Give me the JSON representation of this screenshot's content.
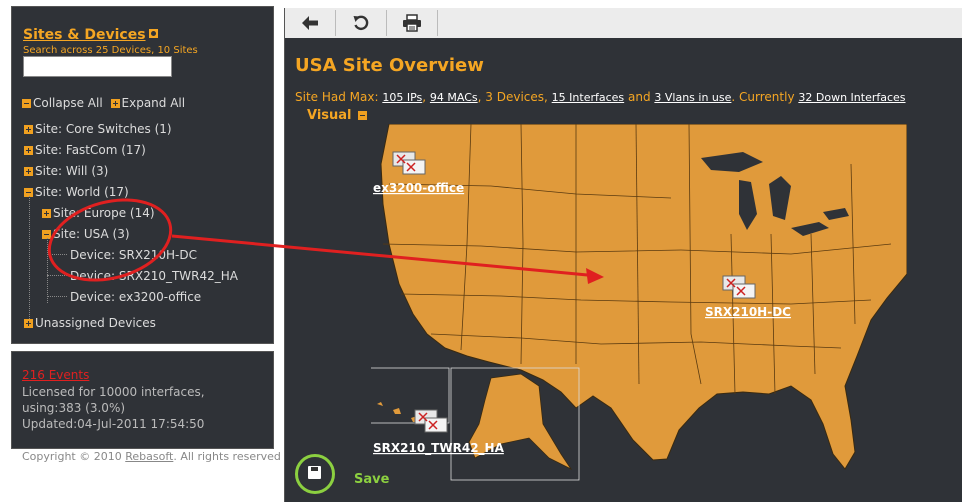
{
  "sidebar": {
    "title": "Sites & Devices",
    "subtitle": "Search across 25 Devices, 10 Sites",
    "search_value": "",
    "collapse_all": "Collapse All",
    "expand_all": "Expand All",
    "tree": {
      "core_switches": "Site: Core Switches (1)",
      "fastcom": "Site: FastCom (17)",
      "will": "Site: Will (3)",
      "world": "Site: World (17)",
      "europe": "Site: Europe (14)",
      "usa": "Site: USA (3)",
      "device_1": "Device: SRX210H-DC",
      "device_2": "Device: SRX210_TWR42_HA",
      "device_3": "Device: ex3200-office",
      "unassigned": "Unassigned Devices"
    }
  },
  "events": {
    "link": "216 Events",
    "licensed": "Licensed for 10000 interfaces, using:383 (3.0%)",
    "updated": "Updated:04-Jul-2011 17:54:50"
  },
  "footer": {
    "copyright_prefix": "Copyright © 2010",
    "brand": "Rebasoft",
    "copyright_suffix": ". All rights reserved"
  },
  "main": {
    "title": "USA Site Overview",
    "summary": {
      "prefix": "Site Had Max:",
      "ips": "105 IPs",
      "macs": "94 MACs",
      "devices": ", 3 Devices,",
      "interfaces": "15 Interfaces",
      "and": "and",
      "vlans": "3 Vlans in use",
      "currently": ". Currently",
      "down": "32 Down Interfaces"
    },
    "visual_label": "Visual",
    "save_label": "Save",
    "devices": {
      "ex3200": "ex3200-office",
      "srx210h": "SRX210H-DC",
      "srx210twr": "SRX210_TWR42_HA"
    }
  },
  "colors": {
    "panel": "#2f3237",
    "accent": "#f5a623",
    "map": "#e09a3b",
    "arrow": "#e02020",
    "save": "#8cd040"
  },
  "icons": {
    "back": "back-arrow-icon",
    "refresh": "refresh-icon",
    "print": "print-icon",
    "save": "save-disk-icon"
  }
}
